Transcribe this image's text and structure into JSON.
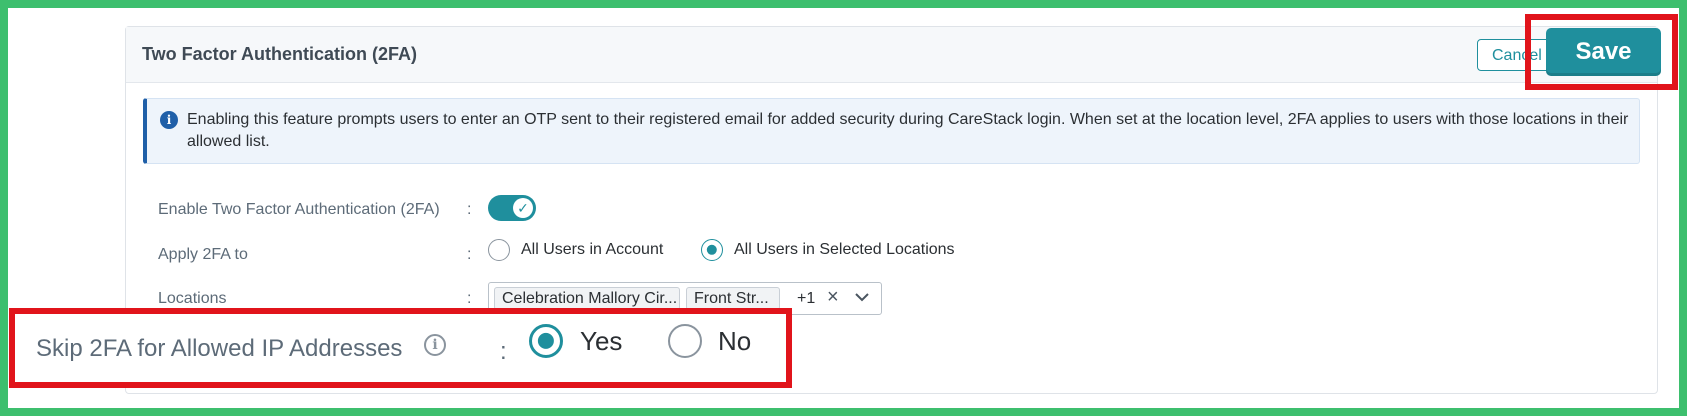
{
  "header": {
    "title": "Two Factor Authentication (2FA)",
    "cancel_label": "Cancel",
    "save_label": "Save"
  },
  "info": {
    "icon": "info-circle-icon",
    "text": "Enabling this feature prompts users to enter an OTP sent to their registered email for added security during CareStack login. When set at the location level, 2FA applies to users with those locations in their allowed list."
  },
  "form": {
    "separator": ":",
    "enable_2fa": {
      "label": "Enable Two Factor Authentication (2FA)",
      "enabled": true
    },
    "apply_to": {
      "label": "Apply 2FA to",
      "options": [
        {
          "label": "All Users in Account",
          "selected": false
        },
        {
          "label": "All Users in Selected Locations",
          "selected": true
        }
      ]
    },
    "locations": {
      "label": "Locations",
      "chips": [
        "Celebration Mallory Cir...",
        "Front Str..."
      ],
      "more_count": "+1"
    },
    "skip_ip": {
      "label": "Skip 2FA for Allowed IP Addresses",
      "options": [
        {
          "label": "Yes",
          "selected": true
        },
        {
          "label": "No",
          "selected": false
        }
      ]
    }
  },
  "colors": {
    "accent": "#1f8f9d",
    "highlight": "#e1141b",
    "frame": "#3dbf6e",
    "info_bar": "#1f5fa8"
  }
}
